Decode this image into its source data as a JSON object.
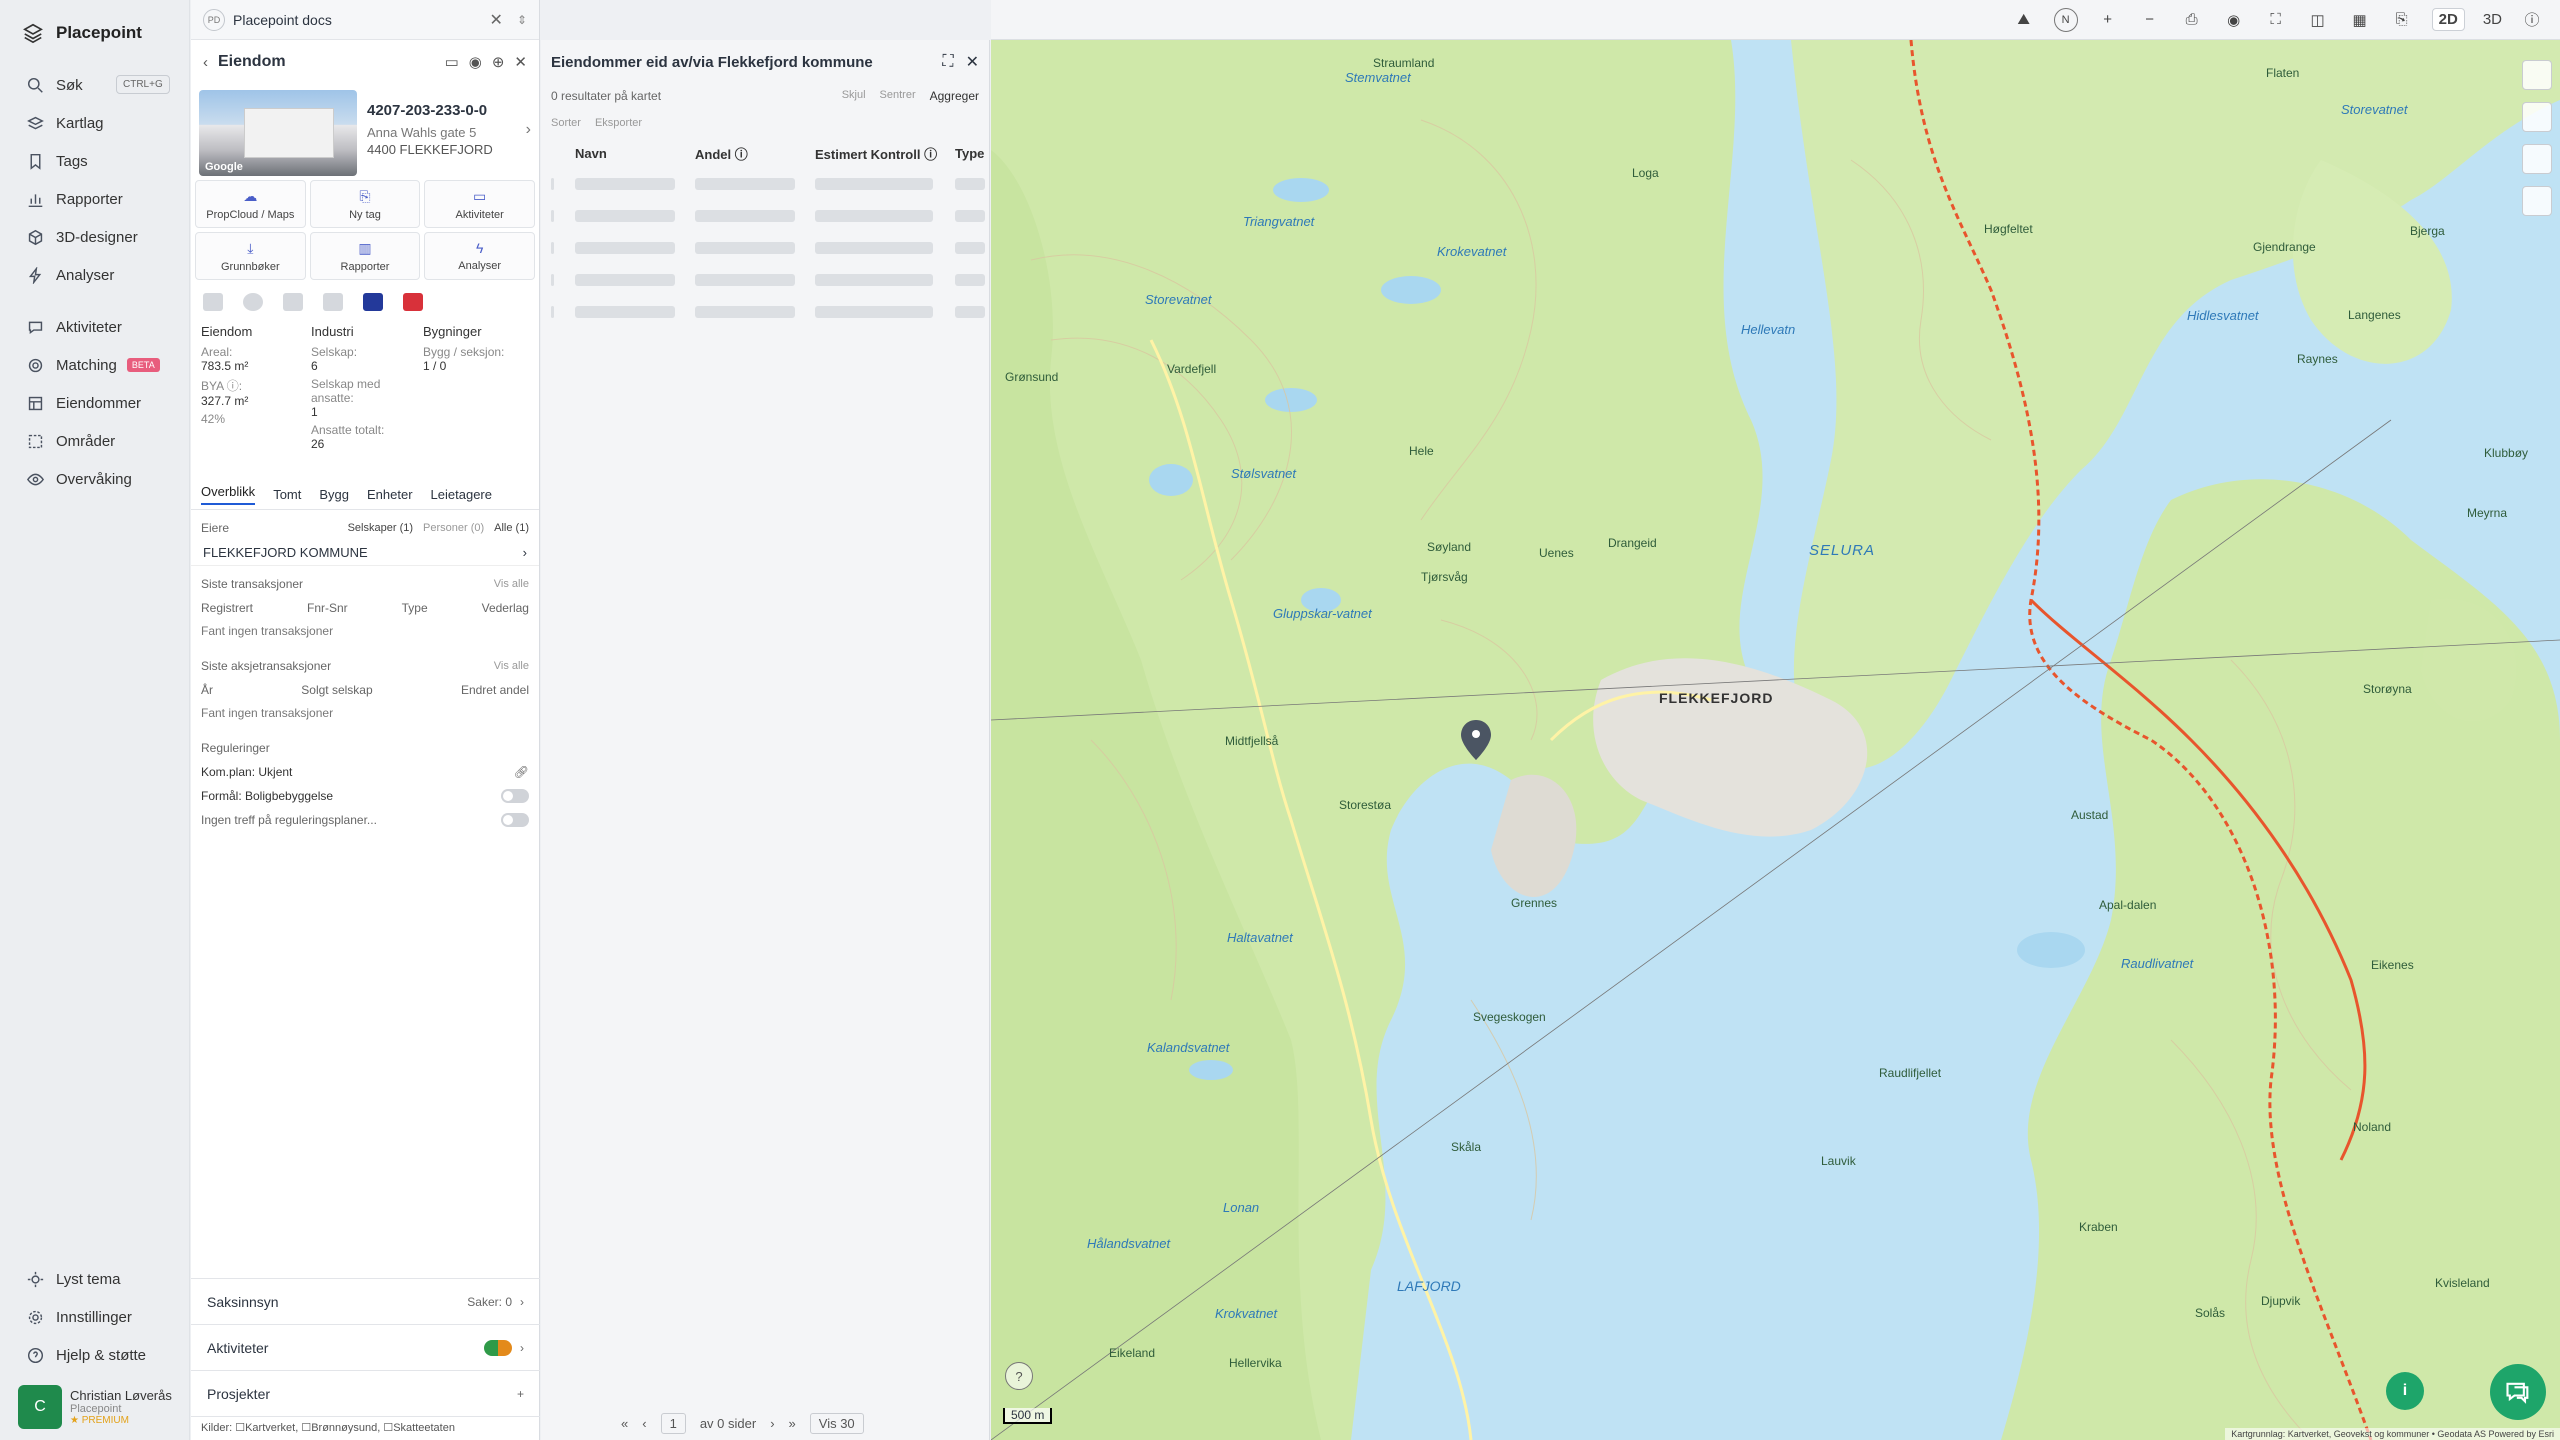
{
  "nav": {
    "brand": "Placepoint",
    "items": [
      {
        "label": "Søk",
        "shortcut": "CTRL+G"
      },
      {
        "label": "Kartlag"
      },
      {
        "label": "Tags"
      },
      {
        "label": "Rapporter"
      },
      {
        "label": "3D-designer"
      },
      {
        "label": "Analyser"
      },
      {
        "label": "Aktiviteter"
      },
      {
        "label": "Matching",
        "badge": "BETA"
      },
      {
        "label": "Eiendommer"
      },
      {
        "label": "Områder"
      },
      {
        "label": "Overvåking"
      }
    ],
    "bottom": [
      {
        "label": "Lyst tema"
      },
      {
        "label": "Innstillinger"
      },
      {
        "label": "Hjelp & støtte"
      }
    ],
    "user": {
      "initial": "C",
      "name": "Christian Løverås",
      "org": "Placepoint",
      "plan": "PREMIUM"
    }
  },
  "panel": {
    "tab": {
      "badge": "PD",
      "title": "Placepoint docs"
    },
    "header": "Eiendom",
    "property": {
      "id": "4207-203-233-0-0",
      "address": "Anna Wahls gate 5",
      "postal": "4400 FLEKKEFJORD",
      "photo_credit": "Google"
    },
    "actions": [
      "PropCloud / Maps",
      "Ny tag",
      "Aktiviteter",
      "Grunnbøker",
      "Rapporter",
      "Analyser"
    ],
    "facts": {
      "col1": {
        "title": "Eiendom",
        "areal_label": "Areal:",
        "areal": "783.5 m²",
        "bya_label": "BYA ⓘ:",
        "bya": "327.7 m²",
        "bya_pct": "42%"
      },
      "col2": {
        "title": "Industri",
        "selskap_label": "Selskap:",
        "selskap": "6",
        "ansatte_label": "Selskap med ansatte:",
        "ansatte": "1",
        "total_label": "Ansatte totalt:",
        "total": "26"
      },
      "col3": {
        "title": "Bygninger",
        "bygg_label": "Bygg / seksjon:",
        "bygg": "1 / 0"
      }
    },
    "subtabs": [
      "Overblikk",
      "Tomt",
      "Bygg",
      "Enheter",
      "Leietagere"
    ],
    "owners": {
      "title": "Eiere",
      "filters": [
        "Selskaper (1)",
        "Personer (0)",
        "Alle (1)"
      ],
      "name": "FLEKKEFJORD KOMMUNE"
    },
    "transactions": {
      "title": "Siste transaksjoner",
      "show_all": "Vis alle",
      "cols": [
        "Registrert",
        "Fnr-Snr",
        "Type",
        "Vederlag"
      ],
      "empty": "Fant ingen transaksjoner"
    },
    "share_tx": {
      "title": "Siste aksjetransaksjoner",
      "show_all": "Vis alle",
      "cols": [
        "År",
        "Solgt selskap",
        "Endret andel"
      ],
      "empty": "Fant ingen transaksjoner"
    },
    "regulations": {
      "title": "Reguleringer",
      "komplan": "Kom.plan: Ukjent",
      "formal": "Formål: Boligbebyggelse",
      "none": "Ingen treff på reguleringsplaner..."
    },
    "bottom": {
      "saksinnsyn": "Saksinnsyn",
      "saker": "Saker: 0",
      "aktiviteter": "Aktiviteter",
      "prosjekter": "Prosjekter"
    },
    "sources": "Kilder: ☐Kartverket, ☐Brønnøysund, ☐Skatteetaten"
  },
  "list": {
    "title": "Eiendommer eid av/via Flekkefjord kommune",
    "results": "0 resultater på kartet",
    "actions": [
      "Skjul",
      "Sentrer",
      "Aggreger"
    ],
    "tools": [
      "Sorter",
      "Eksporter"
    ],
    "columns": [
      "Navn",
      "Andel ⓘ",
      "Estimert Kontroll ⓘ",
      "Type"
    ],
    "pager": {
      "page": "1",
      "of": "av 0 sider",
      "per": "Vis 30"
    }
  },
  "map": {
    "toolbar": [
      "2D",
      "3D"
    ],
    "scale": "500 m",
    "attribution": "Kartgrunnlag: Kartverket, Geovekst og kommuner • Geodata AS Powered by Esri",
    "places": [
      "FLEKKEFJORD",
      "SELURA",
      "LAFJORD",
      "Uenes",
      "Loga",
      "Drangeid",
      "Tjørsvåg",
      "Søyland",
      "Midtfjellså",
      "Storestøa",
      "Grennes",
      "Svegeskogen",
      "Lauvik",
      "Raudlifjellet",
      "Austad",
      "Hidlesvatnet",
      "Storevatnet",
      "Raynes",
      "Langenes",
      "Bjerga",
      "Gjendrange",
      "Høgfeltet",
      "Flaten",
      "Straumland",
      "Vardefjell",
      "Grønsund",
      "Hele",
      "Apal-dalen",
      "Noland",
      "Eikeland",
      "Hellervika",
      "Djupvik",
      "Solås",
      "Kraben",
      "Kvisleland",
      "Skåla",
      "Eikenes",
      "Storøyna",
      "Meyrna",
      "Klubbøy"
    ],
    "lakes": [
      "Stemvatnet",
      "Triangvatnet",
      "Krokevatnet",
      "Storevatnet",
      "Stølsvatnet",
      "Hellevatn",
      "Gluppskar-vatnet",
      "Haltavatnet",
      "Kalandsvatnet",
      "Lonan",
      "Hålandsvatnet",
      "Krokvatnet",
      "Raudlivatnet"
    ]
  }
}
